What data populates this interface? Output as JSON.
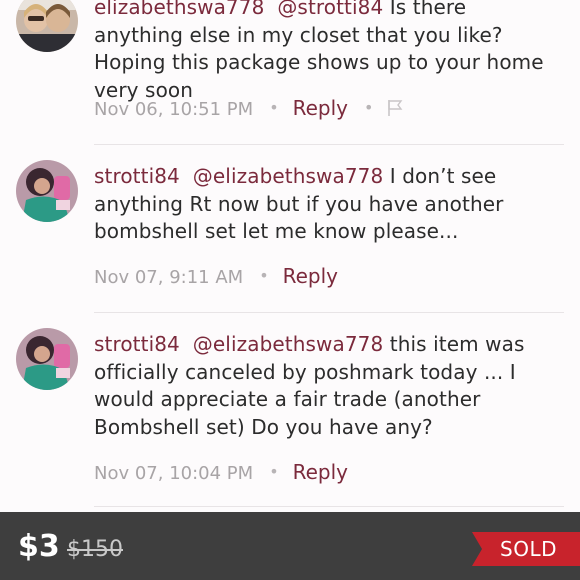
{
  "comments": [
    {
      "username": "elizabethswa778",
      "mention": "@strotti84",
      "text": "Is there anything else in my closet that you like? Hoping this package shows up to your home very soon",
      "time": "Nov 06, 10:51 PM",
      "reply_label": "Reply",
      "has_flag": true
    },
    {
      "username": "strotti84",
      "mention": "@elizabethswa778",
      "text": "I don’t see anything Rt now but if you have another bombshell set let me know please...",
      "time": "Nov 07, 9:11 AM",
      "reply_label": "Reply",
      "has_flag": false
    },
    {
      "username": "strotti84",
      "mention": "@elizabethswa778",
      "text": "this item was officially canceled by poshmark today ... I would appreciate a fair trade (another Bombshell set) Do you have any?",
      "time": "Nov 07, 10:04 PM",
      "reply_label": "Reply",
      "has_flag": false
    }
  ],
  "listing": {
    "price": "$3",
    "original_price": "$150",
    "status": "SOLD"
  },
  "colors": {
    "accent": "#7b2a3c",
    "sold_ribbon": "#c8232c",
    "bottom_bar": "#3e3e3e"
  }
}
